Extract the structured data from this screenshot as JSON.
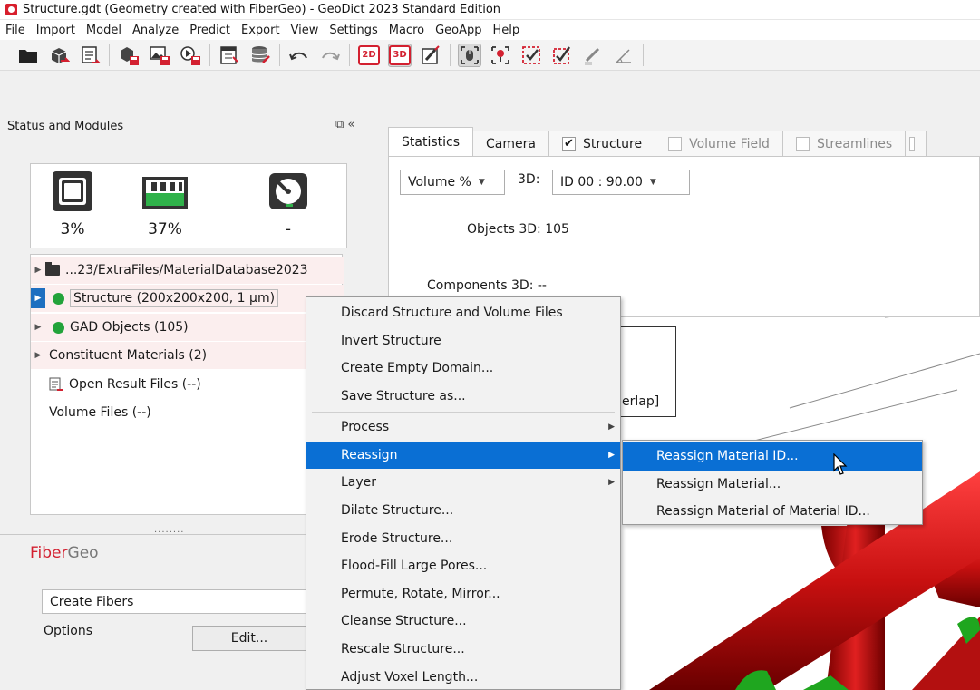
{
  "titlebar": {
    "title": "Structure.gdt (Geometry created with FiberGeo)  -  GeoDict 2023 Standard Edition"
  },
  "menubar": [
    "File",
    "Import",
    "Model",
    "Analyze",
    "Predict",
    "Export",
    "View",
    "Settings",
    "Macro",
    "GeoApp",
    "Help"
  ],
  "toolbar": {
    "btn_2d": "2D",
    "btn_3d": "3D"
  },
  "left_panel": {
    "header": "Status and Modules",
    "controls": "⧉ «",
    "status": {
      "cpu": "3%",
      "memory": "37%",
      "disk": "-"
    },
    "tree": {
      "database": "...23/ExtraFiles/MaterialDatabase2023",
      "structure": "Structure (200x200x200, 1 µm)",
      "gad": "GAD Objects (105)",
      "materials": "Constituent Materials (2)",
      "results": "Open Result Files (--)",
      "volume": "Volume Files (--)"
    },
    "splitter_grip": "........",
    "module_fiber": "Fiber",
    "module_geo": "Geo",
    "create_fibers": "Create Fibers",
    "options_label": "Options",
    "edit_button": "Edit..."
  },
  "tabs": {
    "statistics": "Statistics",
    "camera": "Camera",
    "structure": "Structure",
    "volume_field": "Volume Field",
    "streamlines": "Streamlines"
  },
  "stats": {
    "volume_combo": "Volume %",
    "label_3d": "3D:",
    "id_combo": "ID 00  : 90.00",
    "objects": "Objects 3D: 105",
    "components": "Components 3D: --"
  },
  "view3d": {
    "overlap_text": "erlap]"
  },
  "context_menu": {
    "items": [
      "Discard Structure and Volume Files",
      "Invert Structure",
      "Create Empty Domain...",
      "Save Structure as...",
      "Process",
      "Reassign",
      "Layer",
      "Dilate Structure...",
      "Erode Structure...",
      "Flood-Fill Large Pores...",
      "Permute, Rotate, Mirror...",
      "Cleanse Structure...",
      "Rescale Structure...",
      "Adjust Voxel Length..."
    ]
  },
  "submenu": {
    "items": [
      "Reassign Material ID...",
      "Reassign Material...",
      "Reassign Material of Material ID..."
    ]
  },
  "colors": {
    "accent": "#0a6fd4",
    "brand_red": "#d32030",
    "fiber_red": "#d81818",
    "fiber_green": "#1fa61f"
  }
}
